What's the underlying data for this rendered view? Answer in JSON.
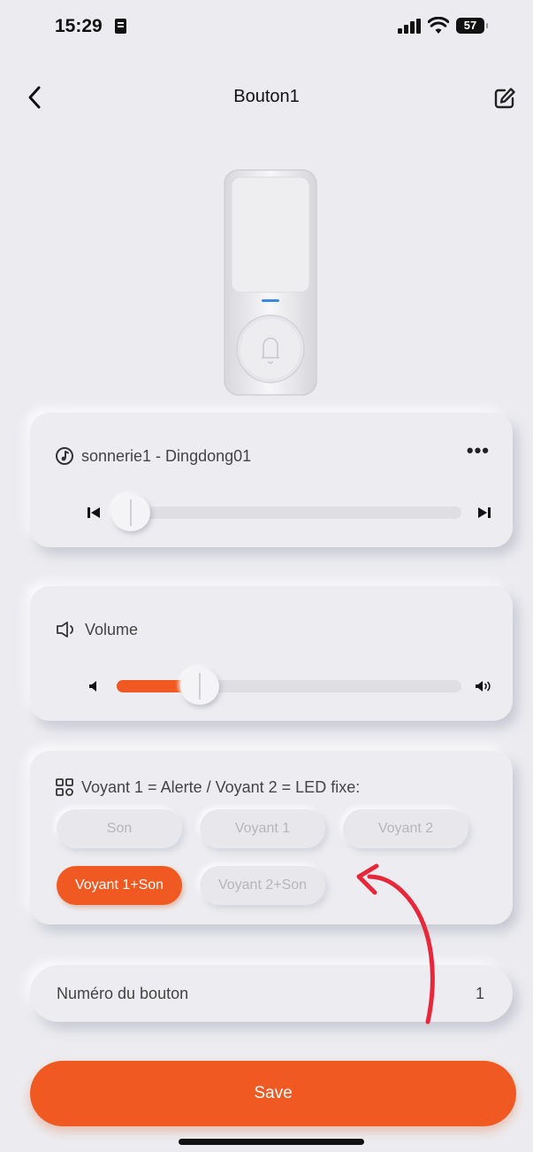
{
  "status_bar": {
    "time": "15:29",
    "battery": "57"
  },
  "header": {
    "title": "Bouton1"
  },
  "ringtone": {
    "label": "sonnerie1 - Dingdong01",
    "more": "•••",
    "progress": 0.04
  },
  "volume": {
    "label": "Volume",
    "level": 0.24
  },
  "mode": {
    "label": "Voyant 1 = Alerte / Voyant 2 = LED fixe:",
    "options": [
      "Son",
      "Voyant 1",
      "Voyant 2",
      "Voyant 1+Son",
      "Voyant 2+Son"
    ],
    "selected": "Voyant 1+Son"
  },
  "button_number": {
    "label": "Numéro du bouton",
    "value": "1"
  },
  "save": {
    "label": "Save"
  },
  "colors": {
    "accent": "#f05a22",
    "background": "#ececf0",
    "annotation_arrow": "#e8283a"
  }
}
